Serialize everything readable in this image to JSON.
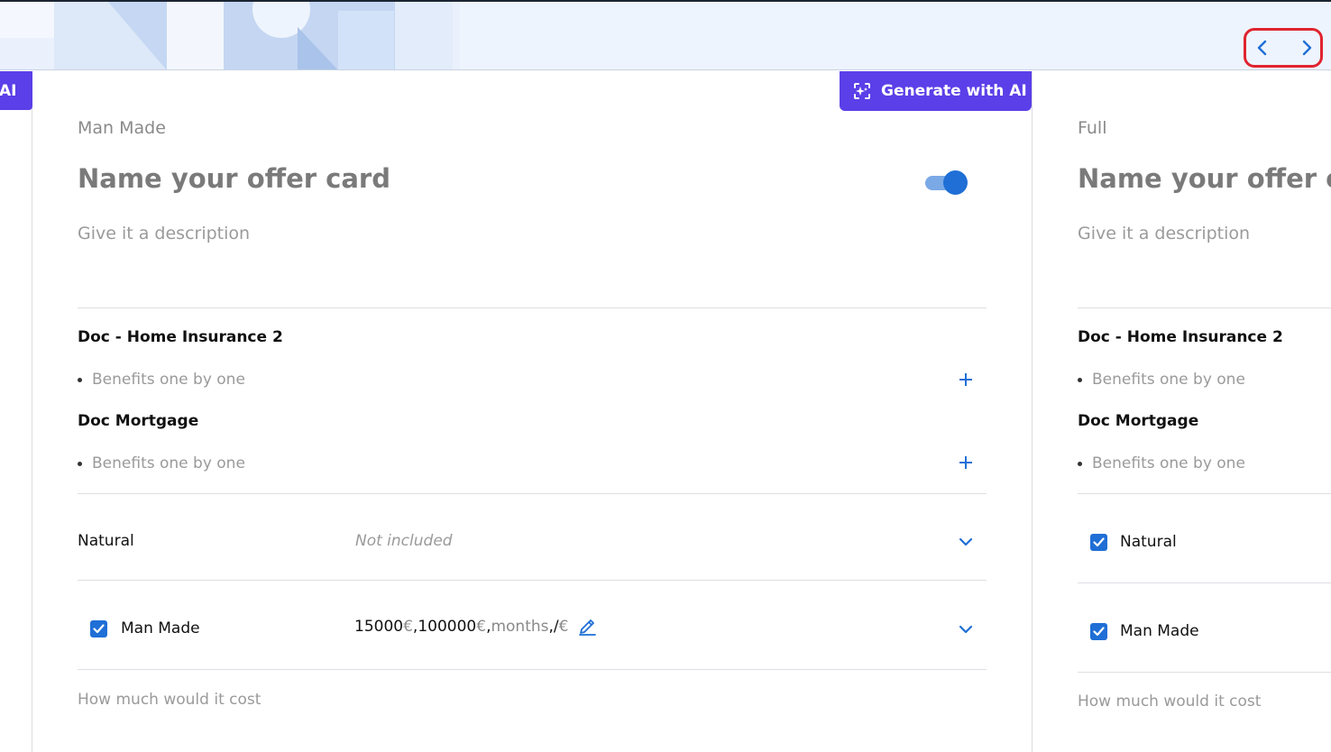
{
  "left_card": {
    "ai_tab_label": "AI"
  },
  "main_card": {
    "generate_label": "Generate with AI",
    "category": "Man Made",
    "title": "Name your offer card",
    "description_placeholder": "Give it a description",
    "docs": [
      {
        "title": "Doc - Home Insurance 2",
        "benefit_placeholder": "Benefits one by one"
      },
      {
        "title": "Doc Mortgage",
        "benefit_placeholder": "Benefits one by one"
      }
    ],
    "coverages": [
      {
        "label": "Natural",
        "value": "Not included"
      },
      {
        "label": "Man Made",
        "checked": true
      }
    ],
    "man_made_values": {
      "v1": "15000",
      "u1": " €",
      "sep1": ", ",
      "v2": "100000",
      "u2": " €",
      "sep2": ", ",
      "v3": "months",
      "sep3": ", ",
      "v4": "/",
      "u4": " €"
    },
    "cost_placeholder": "How much would it cost"
  },
  "right_card": {
    "category": "Full",
    "title": "Name your offer card",
    "description_placeholder": "Give it a description",
    "docs": [
      {
        "title": "Doc - Home Insurance 2",
        "benefit_placeholder": "Benefits one by one"
      },
      {
        "title": "Doc Mortgage",
        "benefit_placeholder": "Benefits one by one"
      }
    ],
    "coverages": [
      {
        "label": "Natural",
        "checked": true
      },
      {
        "label": "Man Made",
        "checked": true
      }
    ],
    "cost_placeholder": "How much would it cost"
  },
  "colors": {
    "accent_purple": "#5b3fe8",
    "accent_blue": "#1f6fd6",
    "highlight_red": "#e0242f"
  },
  "icons": {
    "prev": "chevron-left-icon",
    "next": "chevron-right-icon",
    "generate": "ai-sparkle-icon",
    "add": "plus-icon",
    "expand": "chevron-down-icon",
    "edit": "pencil-icon",
    "check": "check-icon"
  }
}
